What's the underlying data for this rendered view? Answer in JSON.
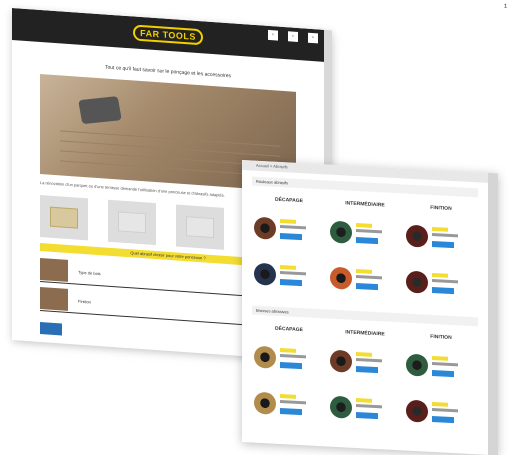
{
  "brand": {
    "logo_text": "FAR TOOLS",
    "accent": "#f3dd30",
    "button_blue": "#2b88d8",
    "dark": "#222222"
  },
  "back_page": {
    "headline": "Tout ce qu'il faut savoir sur le ponçage et les accessoires",
    "body_text": "La rénovation d'un parquet ou d'une terrasse demande l'utilisation d'une ponceuse et d'abrasifs adaptés.",
    "banner_text": "Quel abrasif choisir pour votre ponceuse ?",
    "card_tags": [
      "",
      "",
      ""
    ],
    "row_labels": [
      "Type de bois",
      "Finition"
    ]
  },
  "front_page": {
    "top_bar_text": "Accueil > Abrasifs",
    "sections": [
      {
        "header": "Rouleaux abrasifs",
        "columns": [
          {
            "title": "DÉCAPAGE",
            "subtitle": ""
          },
          {
            "title": "INTERMÉDIAIRE",
            "subtitle": ""
          },
          {
            "title": "FINITION",
            "subtitle": ""
          }
        ]
      },
      {
        "header": "Brosses abrasives",
        "columns": [
          {
            "title": "DÉCAPAGE",
            "subtitle": ""
          },
          {
            "title": "INTERMÉDIAIRE",
            "subtitle": ""
          },
          {
            "title": "FINITION",
            "subtitle": ""
          }
        ]
      }
    ]
  },
  "corner_marker": "¹"
}
